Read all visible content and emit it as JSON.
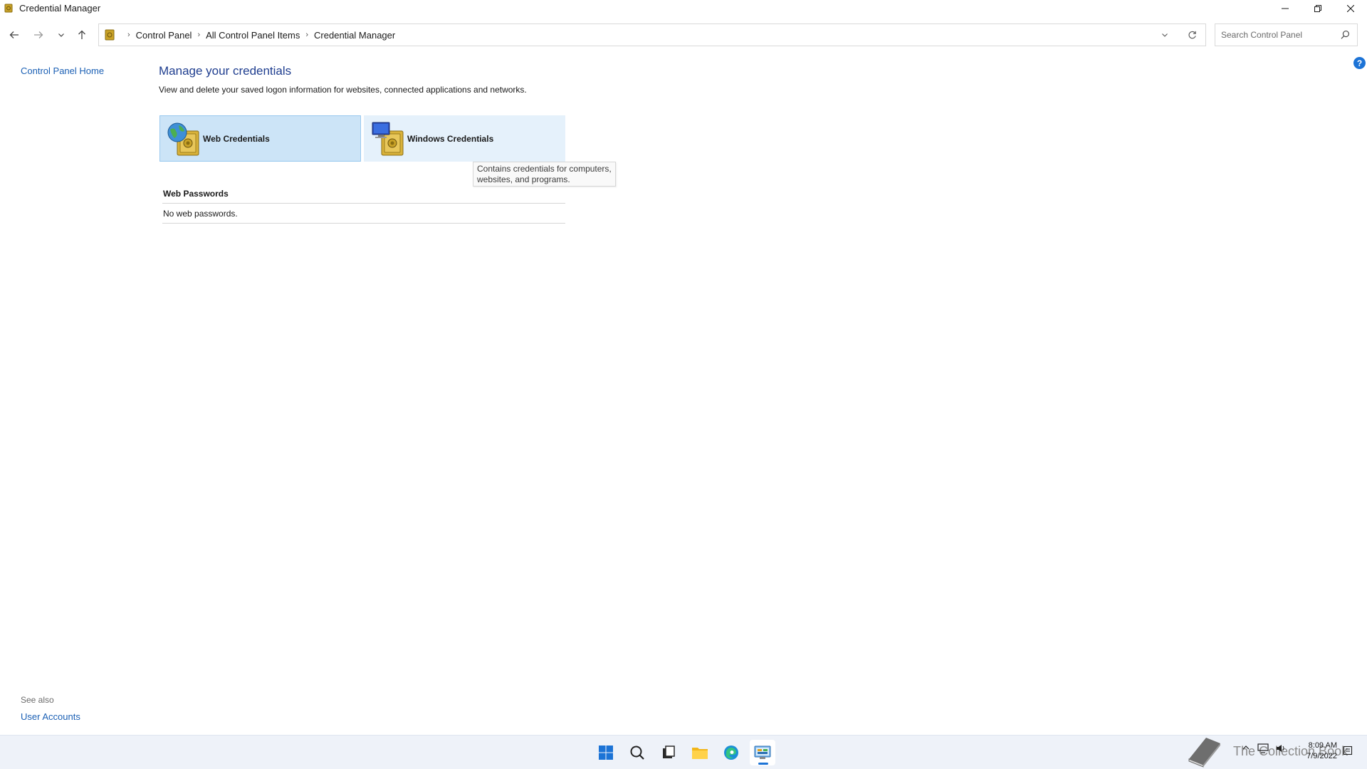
{
  "window": {
    "title": "Credential Manager"
  },
  "address_bar": {
    "crumbs": [
      "Control Panel",
      "All Control Panel Items",
      "Credential Manager"
    ]
  },
  "search": {
    "placeholder": "Search Control Panel"
  },
  "left_pane": {
    "home_link": "Control Panel Home",
    "see_also_label": "See also",
    "see_also_links": [
      "User Accounts"
    ]
  },
  "main": {
    "title": "Manage your credentials",
    "description": "View and delete your saved logon information for websites, connected applications and networks.",
    "tiles": [
      {
        "label": "Web Credentials",
        "selected": true
      },
      {
        "label": "Windows Credentials",
        "selected": false
      }
    ],
    "tooltip": "Contains credentials for computers, websites, and programs.",
    "section": {
      "title": "Web Passwords",
      "empty_text": "No web passwords."
    }
  },
  "taskbar": {
    "pinned": [
      "start-icon",
      "search-icon",
      "task-view-icon",
      "file-explorer-icon",
      "edge-icon",
      "control-panel-icon"
    ],
    "active": "control-panel-icon",
    "watermark": "The Collection Book",
    "clock": {
      "time": "8:09 AM",
      "date": "7/9/2022"
    }
  },
  "colors": {
    "link": "#1a5fb4",
    "title": "#1e3d8f",
    "tile_selected": "#cce4f7",
    "tile": "#e5f1fb",
    "accent": "#1c73d6"
  }
}
